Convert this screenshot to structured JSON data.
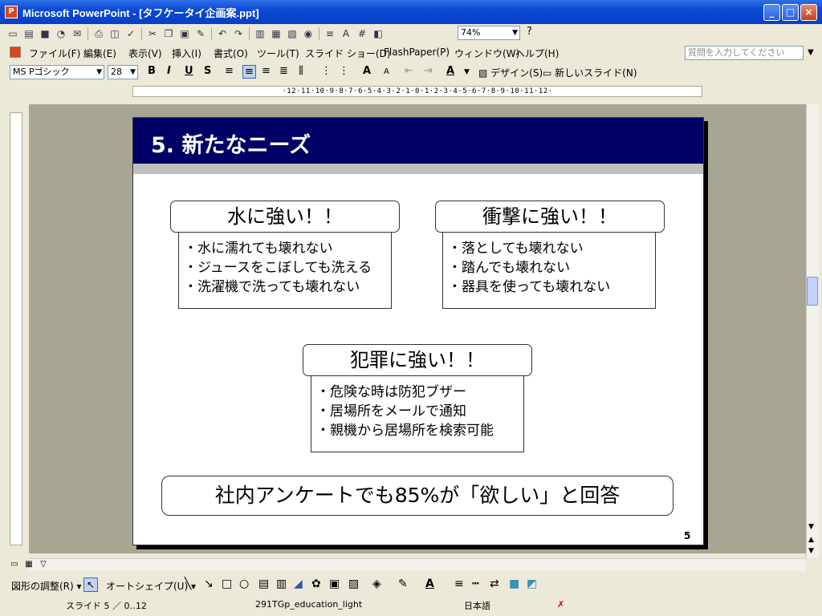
{
  "window": {
    "title": "Microsoft PowerPoint - [タフケータイ企画案.ppt]",
    "app_icon": "P"
  },
  "toolbar": {
    "zoom": "74%"
  },
  "menu": {
    "items": [
      "ファイル(F)",
      "編集(E)",
      "表示(V)",
      "挿入(I)",
      "書式(O)",
      "ツール(T)",
      "スライド ショー(D)",
      "FlashPaper(P)",
      "ウィンドウ(W)",
      "ヘルプ(H)"
    ],
    "help_placeholder": "質問を入力してください"
  },
  "format": {
    "font": "MS Pゴシック",
    "size": "28",
    "design": "デザイン(S)",
    "new_slide": "新しいスライド(N)"
  },
  "ruler": {
    "h": "·12·11·10·9·8·7·6·5·4·3·2·1·0·1·2·3·4·5·6·7·8·9·10·11·12·"
  },
  "slide": {
    "title": "5. 新たなニーズ",
    "box1": {
      "title": "水に強い！！",
      "lines": [
        "・水に濡れても壊れない",
        "・ジュースをこぼしても洗える",
        "・洗濯機で洗っても壊れない"
      ]
    },
    "box2": {
      "title": "衝撃に強い！！",
      "lines": [
        "・落としても壊れない",
        "・踏んでも壊れない",
        "・器具を使っても壊れない"
      ]
    },
    "box3": {
      "title": "犯罪に強い！！",
      "lines": [
        "・危険な時は防犯ブザー",
        "・居場所をメールで通知",
        "・親機から居場所を検索可能"
      ]
    },
    "footer": "社内アンケートでも85%が「欲しい」と回答",
    "number": "5"
  },
  "drawbar": {
    "adjust": "図形の調整(R)",
    "autoshape": "オートシェイプ(U)"
  },
  "status": {
    "slide": "スライド 5 ／ 0‥12",
    "template": "291TGp_education_light",
    "language": "日本語"
  }
}
